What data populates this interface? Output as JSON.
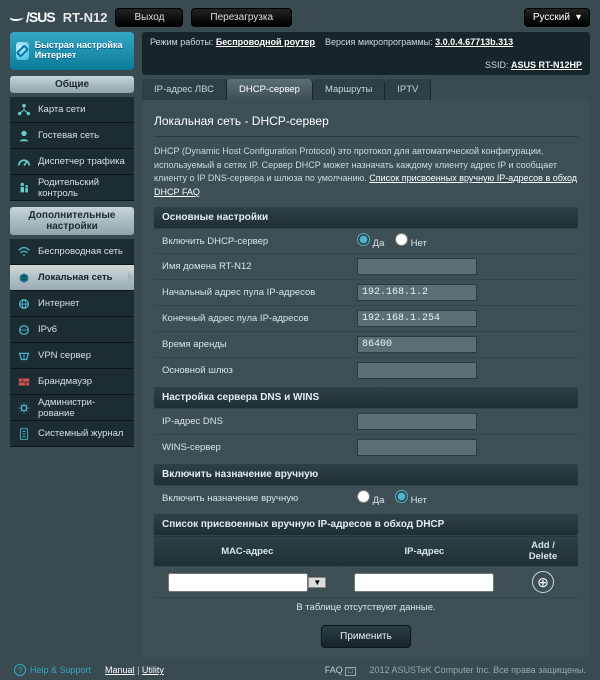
{
  "header": {
    "brand": "/SUS",
    "model": "RT-N12",
    "logout": "Выход",
    "reboot": "Перезагрузка",
    "language": "Русский"
  },
  "infobar": {
    "mode_label": "Режим работы:",
    "mode_link": "Беспроводной роутер",
    "fw_label": "Версия микропрограммы:",
    "fw_link": "3.0.0.4.67713b.313",
    "ssid_label": "SSID:",
    "ssid_link": "ASUS RT-N12HP"
  },
  "tabs": {
    "lan_ip": "IP-адрес ЛВС",
    "dhcp": "DHCP-сервер",
    "routes": "Маршруты",
    "iptv": "IPTV"
  },
  "panel": {
    "title": "Локальная сеть - DHCP-сервер",
    "desc_1": "DHCP (Dynamic Host Configuration Protocol) это протокол для автоматической конфигурации, используемый в сетях IP. Сервер DHCP может назначать каждому клиенту адрес IP и сообщает клиенту о IP DNS-сервера и шлюза по умолчанию.",
    "desc_link": "Список присвоенных вручную IP-адресов в обход DHCP FAQ"
  },
  "sections": {
    "basic": "Основные настройки",
    "dns": "Настройка сервера DNS и WINS",
    "manual": "Включить назначение вручную",
    "list": "Список присвоенных вручную IP-адресов в обход DHCP"
  },
  "fields": {
    "enable_dhcp": "Включить DHCP-сервер",
    "domain_name": "Имя домена RT-N12",
    "pool_start": "Начальный адрес пула IP-адресов",
    "pool_end": "Конечный адрес пула IP-адресов",
    "lease": "Время аренды",
    "gateway": "Основной шлюз",
    "dns_ip": "IP-адрес DNS",
    "wins": "WINS-сервер",
    "manual_enable": "Включить назначение вручную",
    "yes": "Да",
    "no": "Нет"
  },
  "values": {
    "domain_name": "",
    "pool_start": "192.168.1.2",
    "pool_end": "192.168.1.254",
    "lease": "86400",
    "gateway": "",
    "dns_ip": "",
    "wins": ""
  },
  "mac_table": {
    "col_mac": "МАС-адрес",
    "col_ip": "IP-адрес",
    "col_action": "Add / Delete",
    "empty": "В таблице отсутствуют данные."
  },
  "apply": "Применить",
  "sidebar": {
    "quick": "Быстрая настройка Интернет",
    "general": "Общие",
    "advanced": "Дополнительные настройки",
    "items_general": [
      "Карта сети",
      "Гостевая сеть",
      "Диспетчер трафика",
      "Родительский контроль"
    ],
    "items_adv": [
      "Беспроводная сеть",
      "Локальная сеть",
      "Интернет",
      "IPv6",
      "VPN сервер",
      "Брандмауэр",
      "Администри-рование",
      "Системный журнал"
    ]
  },
  "footer": {
    "help": "Help & Support",
    "manual": "Manual",
    "utility": "Utility",
    "faq": "FAQ",
    "copyright": "2012 ASUSTeK Computer Inc. Все права защищены."
  }
}
